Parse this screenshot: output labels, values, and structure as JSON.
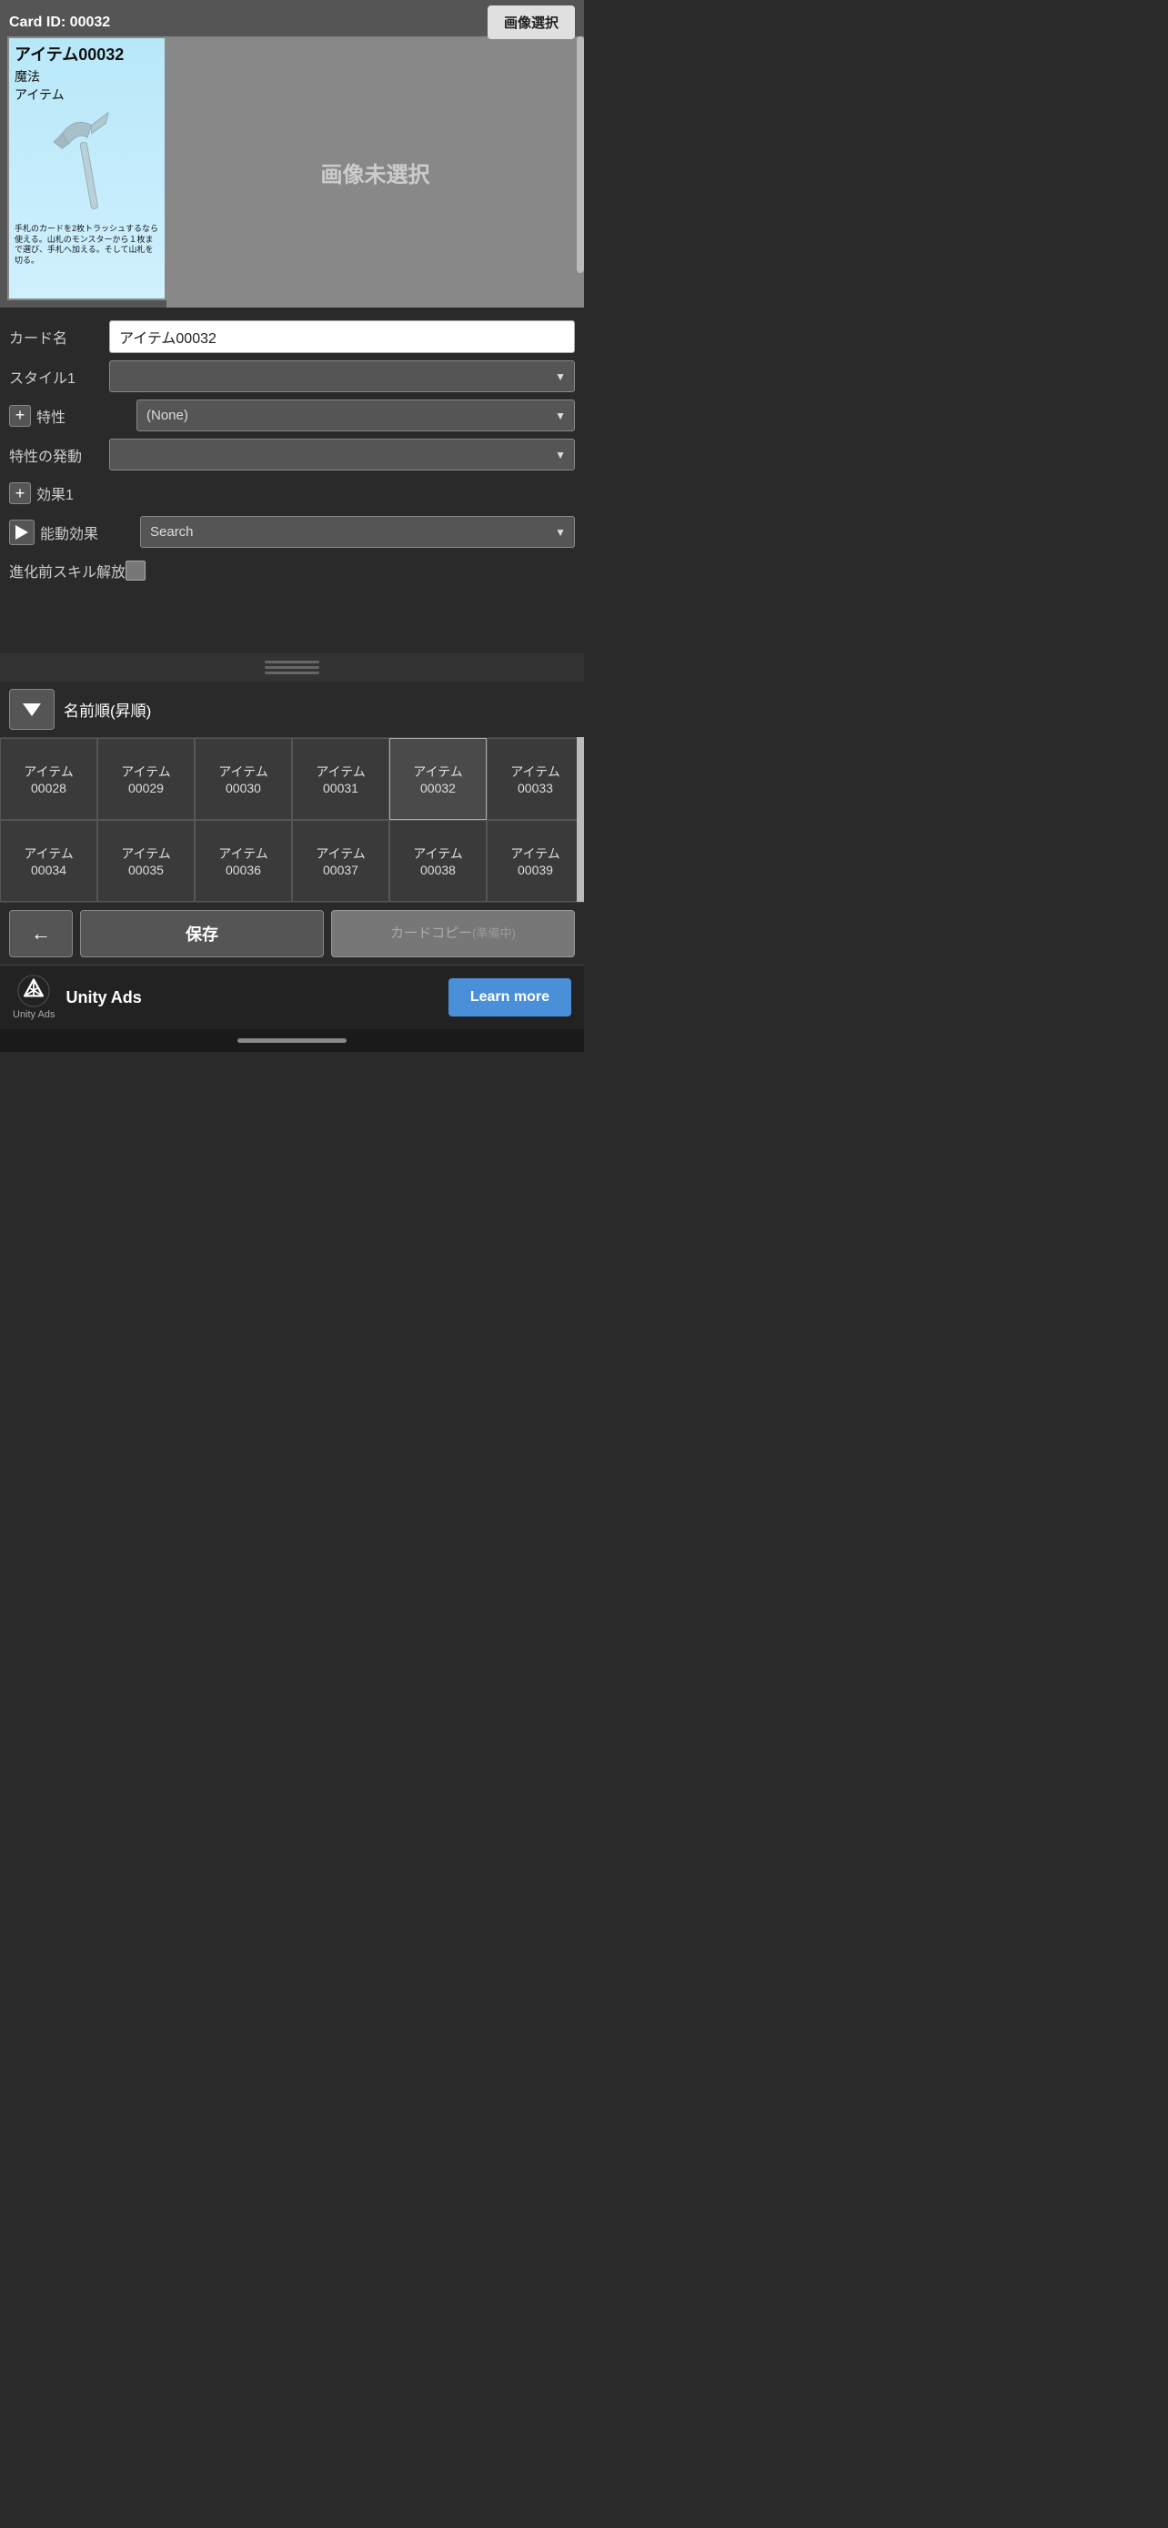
{
  "card": {
    "id": "Card ID: 00032",
    "name": "アイテム00032",
    "subtitle1": "魔法",
    "subtitle2": "アイテム",
    "description": "手札のカードを2枚トラッシュするなら使える。山札のモンスターから１枚まで選び、手札へ加える。そして山札を切る。",
    "no_image_text": "画像未選択"
  },
  "buttons": {
    "image_select": "画像選択",
    "save": "保存",
    "copy": "カードコピー\n(準備中)",
    "learn_more": "Learn more"
  },
  "form": {
    "card_name_label": "カード名",
    "card_name_value": "アイテム00032",
    "style1_label": "スタイル1",
    "trait_label": "特性",
    "trait_value": "(None)",
    "trait_trigger_label": "特性の発動",
    "effect1_label": "効果1",
    "active_effect_label": "能動効果",
    "active_effect_placeholder": "Search",
    "pre_evo_label": "進化前スキル解放"
  },
  "sort": {
    "label": "名前順(昇順)"
  },
  "grid_cards": [
    "アイテム\n00028",
    "アイテム\n00029",
    "アイテム\n00030",
    "アイテム\n00031",
    "アイテム\n00032",
    "アイテム\n00033",
    "アイテム\n00034",
    "アイテム\n00035",
    "アイテム\n00036",
    "アイテム\n00037",
    "アイテム\n00038",
    "アイテム\n00039"
  ],
  "unity_ads": {
    "brand": "Unity Ads",
    "small_label": "Unity  Ads",
    "learn_more": "Learn more"
  },
  "icons": {
    "plus": "+",
    "back_arrow": "←",
    "play": "▶"
  }
}
